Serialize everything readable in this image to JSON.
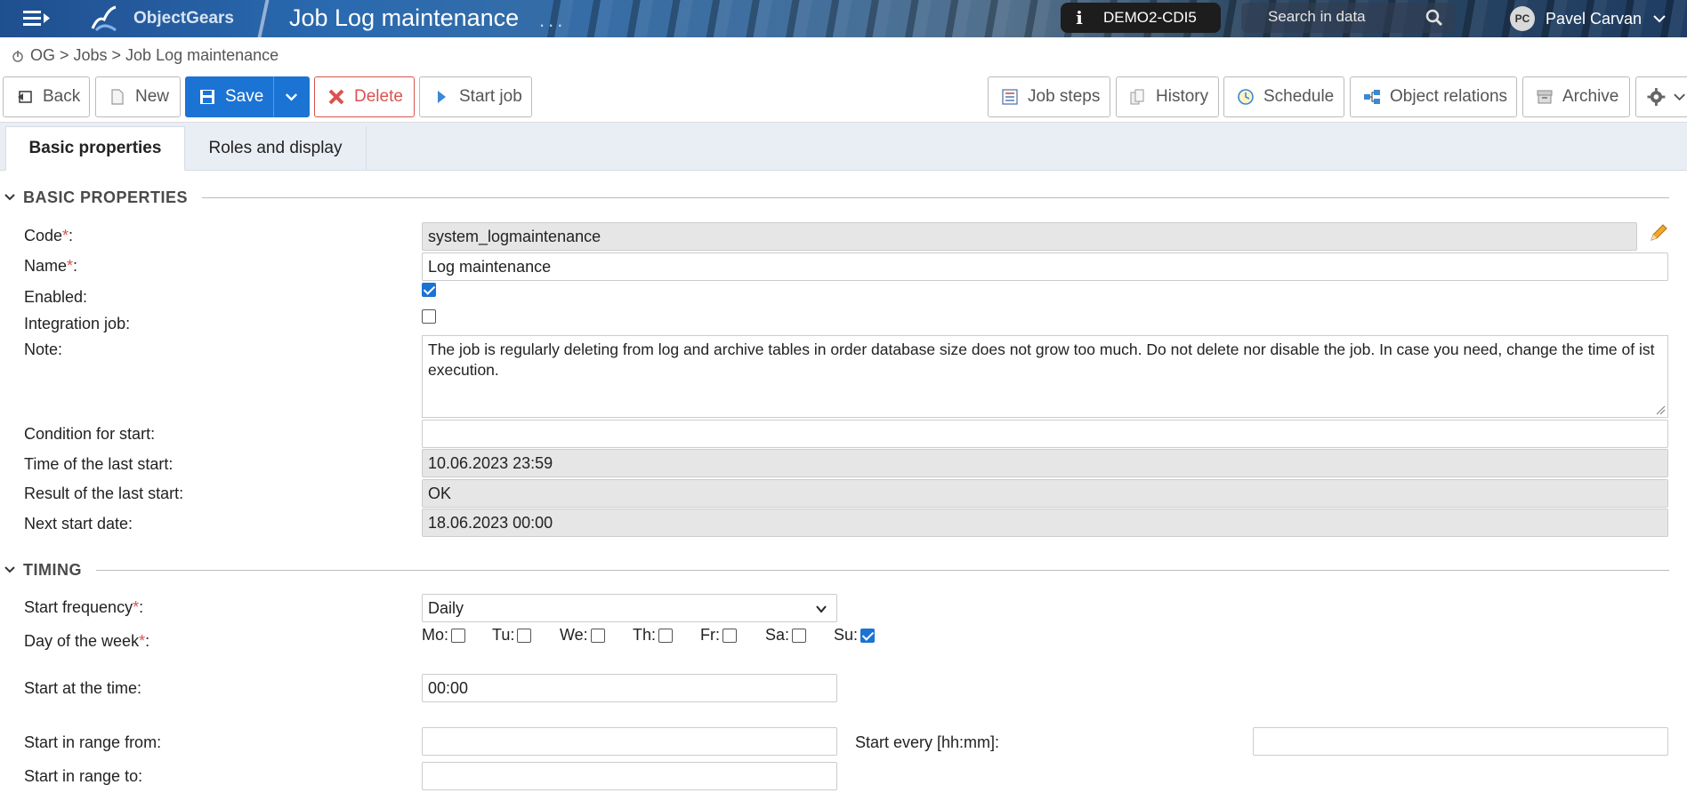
{
  "header": {
    "app_name": "ObjectGears",
    "page_title": "Job Log maintenance",
    "title_dots": "...",
    "environment": "DEMO2-CDI5",
    "search_placeholder": "Search in data",
    "user_initials": "PC",
    "user_name": "Pavel Carvan"
  },
  "breadcrumb": "OG > Jobs > Job Log maintenance",
  "toolbar": {
    "back": "Back",
    "new": "New",
    "save": "Save",
    "delete": "Delete",
    "start_job": "Start job",
    "job_steps": "Job steps",
    "history": "History",
    "schedule": "Schedule",
    "object_relations": "Object relations",
    "archive": "Archive"
  },
  "tabs": [
    {
      "label": "Basic properties",
      "active": true
    },
    {
      "label": "Roles and display",
      "active": false
    }
  ],
  "basic": {
    "section_title": "BASIC PROPERTIES",
    "code_label": "Code",
    "code_value": "system_logmaintenance",
    "name_label": "Name",
    "name_value": "Log maintenance",
    "enabled_label": "Enabled:",
    "enabled": true,
    "integration_label": "Integration job:",
    "integration": false,
    "note_label": "Note:",
    "note_value": "The job is regularly deleting from log and archive tables in order database size does not grow too much. Do not delete nor disable the job. In case you need, change the time of ist execution.",
    "condition_label": "Condition for start:",
    "condition_value": "",
    "last_start_label": "Time of the last start:",
    "last_start_value": "10.06.2023 23:59",
    "result_label": "Result of the last start:",
    "result_value": "OK",
    "next_start_label": "Next start date:",
    "next_start_value": "18.06.2023 00:00"
  },
  "timing": {
    "section_title": "TIMING",
    "frequency_label": "Start frequency",
    "frequency_value": "Daily",
    "day_label": "Day of the week",
    "days": [
      {
        "label": "Mo:",
        "checked": false
      },
      {
        "label": "Tu:",
        "checked": false
      },
      {
        "label": "We:",
        "checked": false
      },
      {
        "label": "Th:",
        "checked": false
      },
      {
        "label": "Fr:",
        "checked": false
      },
      {
        "label": "Sa:",
        "checked": false
      },
      {
        "label": "Su:",
        "checked": true
      }
    ],
    "start_time_label": "Start at the time:",
    "start_time_value": "00:00",
    "range_from_label": "Start in range from:",
    "range_from_value": "",
    "start_every_label": "Start every [hh:mm]:",
    "start_every_value": "",
    "range_to_label": "Start in range to:",
    "range_to_value": ""
  },
  "colors": {
    "primary": "#1b73d3",
    "danger": "#d9534f",
    "required": "#d9534f"
  }
}
